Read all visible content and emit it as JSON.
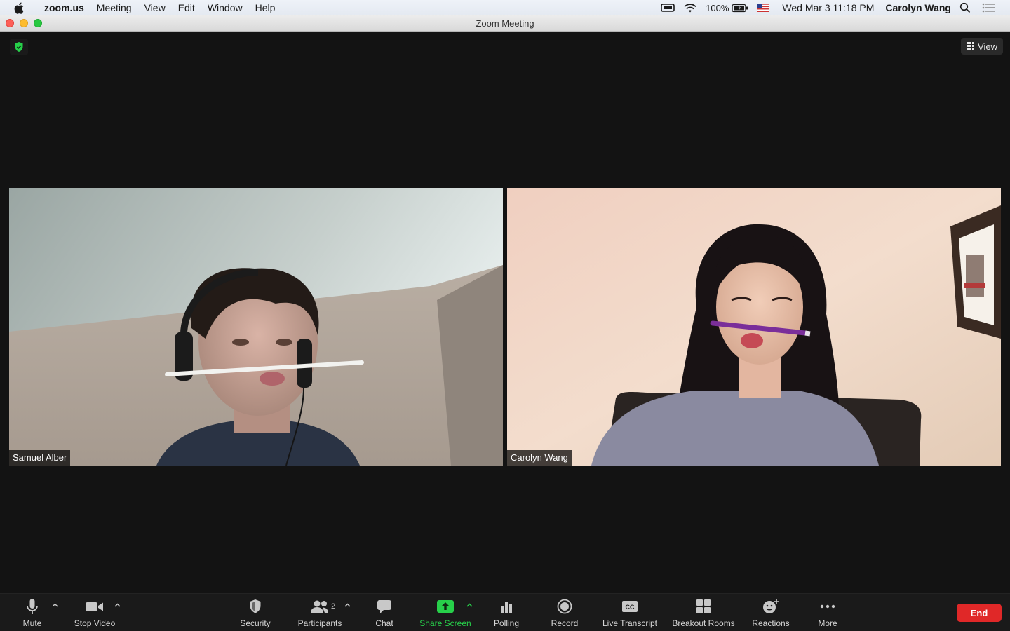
{
  "menubar": {
    "app_name": "zoom.us",
    "items": [
      "Meeting",
      "View",
      "Edit",
      "Window",
      "Help"
    ],
    "battery_percent": "100%",
    "datetime": "Wed Mar 3  11:18 PM",
    "user": "Carolyn Wang"
  },
  "window": {
    "title": "Zoom Meeting"
  },
  "meeting": {
    "view_label": "View",
    "participants": [
      {
        "name": "Samuel Alber"
      },
      {
        "name": "Carolyn Wang"
      }
    ]
  },
  "toolbar": {
    "mute_label": "Mute",
    "stop_video_label": "Stop Video",
    "security_label": "Security",
    "participants_label": "Participants",
    "participants_count": "2",
    "chat_label": "Chat",
    "share_screen_label": "Share Screen",
    "polling_label": "Polling",
    "record_label": "Record",
    "live_transcript_label": "Live Transcript",
    "breakout_rooms_label": "Breakout Rooms",
    "reactions_label": "Reactions",
    "more_label": "More",
    "end_label": "End"
  },
  "colors": {
    "share_screen_accent": "#27d04a",
    "end_button": "#e02828",
    "security_badge": "#27d04a"
  }
}
